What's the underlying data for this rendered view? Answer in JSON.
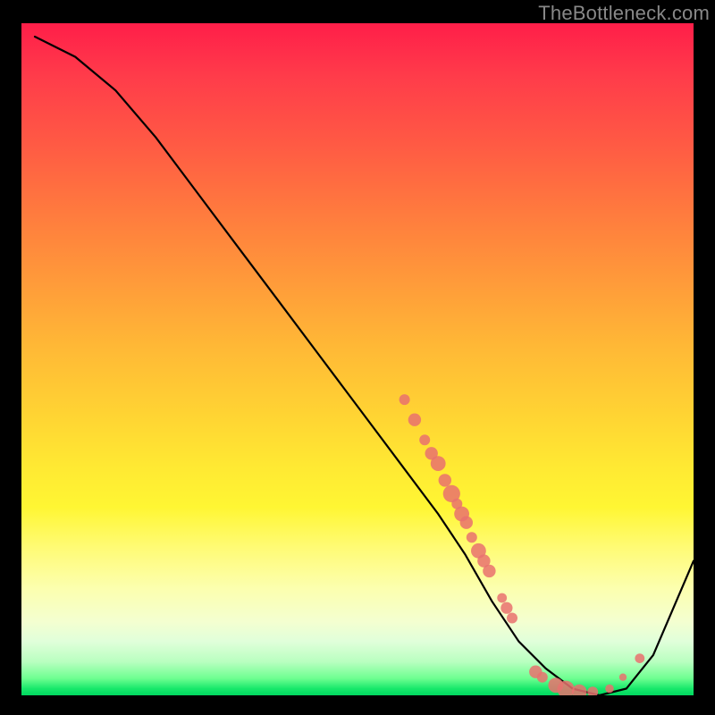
{
  "watermark": "TheBottleneck.com",
  "chart_data": {
    "type": "line",
    "title": "",
    "xlabel": "",
    "ylabel": "",
    "xlim": [
      0,
      100
    ],
    "ylim": [
      0,
      100
    ],
    "grid": false,
    "legend": false,
    "series": [
      {
        "name": "curve",
        "x": [
          2,
          8,
          14,
          20,
          26,
          32,
          38,
          44,
          50,
          56,
          62,
          66,
          70,
          74,
          78,
          82,
          86,
          90,
          94,
          100
        ],
        "y": [
          98,
          95,
          90,
          83,
          75,
          67,
          59,
          51,
          43,
          35,
          27,
          21,
          14,
          8,
          4,
          1,
          0,
          1,
          6,
          20
        ]
      }
    ],
    "markers": [
      {
        "x": 57,
        "y": 44,
        "r": 1.0
      },
      {
        "x": 58.5,
        "y": 41,
        "r": 1.2
      },
      {
        "x": 60,
        "y": 38,
        "r": 1.0
      },
      {
        "x": 61,
        "y": 36,
        "r": 1.2
      },
      {
        "x": 62,
        "y": 34.5,
        "r": 1.4
      },
      {
        "x": 63,
        "y": 32,
        "r": 1.2
      },
      {
        "x": 64,
        "y": 30,
        "r": 1.6
      },
      {
        "x": 64.8,
        "y": 28.5,
        "r": 1.0
      },
      {
        "x": 65.5,
        "y": 27,
        "r": 1.4
      },
      {
        "x": 66.2,
        "y": 25.7,
        "r": 1.2
      },
      {
        "x": 67,
        "y": 23.5,
        "r": 1.0
      },
      {
        "x": 68,
        "y": 21.5,
        "r": 1.4
      },
      {
        "x": 68.8,
        "y": 20,
        "r": 1.2
      },
      {
        "x": 69.6,
        "y": 18.5,
        "r": 1.2
      },
      {
        "x": 71.5,
        "y": 14.5,
        "r": 0.9
      },
      {
        "x": 72.2,
        "y": 13,
        "r": 1.1
      },
      {
        "x": 73,
        "y": 11.5,
        "r": 1.0
      },
      {
        "x": 76.5,
        "y": 3.5,
        "r": 1.2
      },
      {
        "x": 77.5,
        "y": 2.7,
        "r": 1.0
      },
      {
        "x": 79.5,
        "y": 1.5,
        "r": 1.4
      },
      {
        "x": 81,
        "y": 0.9,
        "r": 1.6
      },
      {
        "x": 83,
        "y": 0.5,
        "r": 1.4
      },
      {
        "x": 85,
        "y": 0.5,
        "r": 1.0
      },
      {
        "x": 87.5,
        "y": 1.0,
        "r": 0.8
      },
      {
        "x": 89.5,
        "y": 2.7,
        "r": 0.7
      },
      {
        "x": 92,
        "y": 5.5,
        "r": 0.9
      }
    ],
    "background_gradient": {
      "direction": "vertical",
      "stops": [
        {
          "pos": 0,
          "color": "#ff1e49"
        },
        {
          "pos": 18,
          "color": "#ff5a44"
        },
        {
          "pos": 38,
          "color": "#ff993a"
        },
        {
          "pos": 58,
          "color": "#ffd333"
        },
        {
          "pos": 78,
          "color": "#fffb75"
        },
        {
          "pos": 92,
          "color": "#e0ffda"
        },
        {
          "pos": 100,
          "color": "#00d85f"
        }
      ]
    },
    "marker_color": "#e9716f",
    "line_color": "#000000"
  }
}
